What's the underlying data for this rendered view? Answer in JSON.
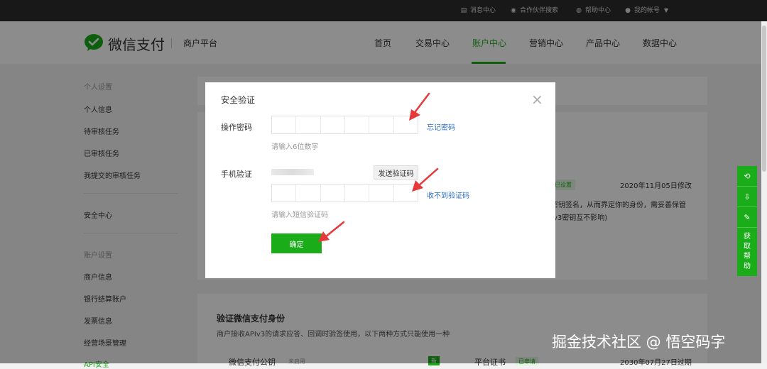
{
  "topbar": {
    "messages": "消息中心",
    "partner": "合作伙伴搜索",
    "help": "帮助中心",
    "account": "我的帐号"
  },
  "header": {
    "brand": "微信支付",
    "subtitle": "商户平台",
    "nav": [
      "首页",
      "交易中心",
      "账户中心",
      "营销中心",
      "产品中心",
      "数据中心"
    ],
    "active_nav": "账户中心",
    "brand_color": "#1aad19"
  },
  "sidebar": {
    "group1": "个人设置",
    "items1": [
      "个人信息",
      "待审核任务",
      "已审核任务",
      "我提交的审核任务"
    ],
    "security": "安全中心",
    "group2": "账户设置",
    "items2": [
      "商户信息",
      "银行结算账户",
      "发票信息",
      "经营场景管理",
      "API安全"
    ]
  },
  "background": {
    "tag": "已设置",
    "date": "2020年11月05日修改",
    "line1": "密钥签名，从而界定你的身份，需妥善保管",
    "line2": "Iv3密钥互不影响)",
    "section_title": "验证微信支付身份",
    "section_desc": "商户接收APIv3的请求应答、回调时验签使用，以下两种方式只能使用一种",
    "sub_left": "微信支付公钥",
    "sub_left_hint": "未启用",
    "sub_left_badge": "新",
    "sub_right": "平台证书",
    "sub_right_badge": "已申请",
    "sub_right_date": "2030年07月27日过期"
  },
  "modal": {
    "title": "安全验证",
    "password_label": "操作密码",
    "forgot_link": "忘记密码",
    "password_hint": "请输入6位数字",
    "phone_label": "手机验证",
    "send_code": "发送验证码",
    "no_code_link": "收不到验证码",
    "code_hint": "请输入短信验证码",
    "confirm": "确定"
  },
  "float_help": {
    "label": "获取帮助"
  },
  "watermark": "掘金技术社区 @ 悟空码字"
}
